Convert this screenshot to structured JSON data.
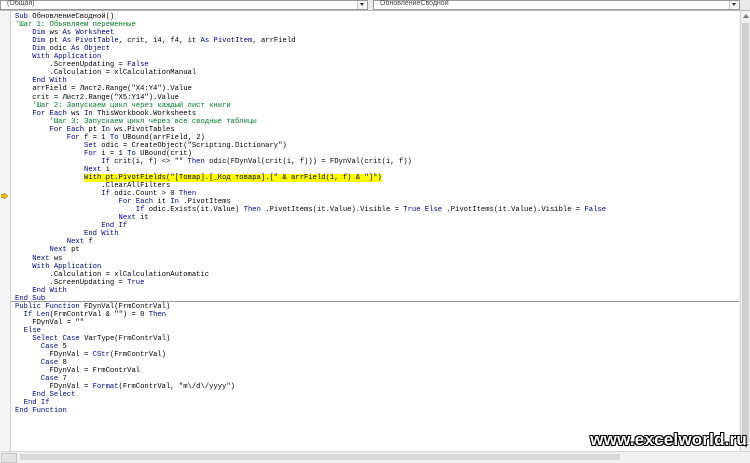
{
  "header": {
    "object_combo": "(Общая)",
    "procedure_combo": "ОбновлениеСводной"
  },
  "watermark": "www.excelworld.ru",
  "code_lines": [
    "Sub ОбновлениеСводной()",
    "'Шаг 1: Объявляем переменные",
    "    Dim ws As Worksheet",
    "    Dim pt As PivotTable, crit, i4, f4, it As PivotItem, arrField",
    "    Dim odic As Object",
    "    With Application",
    "        .ScreenUpdating = False",
    "        .Calculation = xlCalculationManual",
    "    End With",
    "    arrField = Лист2.Range(\"X4:Y4\").Value",
    "    crit = Лист2.Range(\"X5:Y14\").Value",
    "    'Шаг 2: Запускаем цикл через каждый лист книги",
    "    For Each ws In ThisWorkbook.Worksheets",
    "        'Шаг 3: Запускаем цикл через все сводные таблицы",
    "        For Each pt In ws.PivotTables",
    "            For f = 1 To UBound(arrField, 2)",
    "                Set odic = CreateObject(\"Scripting.Dictionary\")",
    "                For i = 1 To UBound(crit)",
    "                    If crit(i, f) <> \"\" Then odic(FDynVal(crit(i, f))) = FDynVal(crit(i, f))",
    "                Next i",
    "                With pt.PivotFields(\"[Товар].[_Код товара].[\" & arrField(1, f) & \"]\")",
    "                    .ClearAllFilters",
    "                    If odic.Count > 0 Then",
    "                        For Each it In .PivotItems",
    "                            If odic.Exists(it.Value) Then .PivotItems(it.Value).Visible = True Else .PivotItems(it.Value).Visible = False",
    "                        Next it",
    "                    End If",
    "                End With",
    "            Next f",
    "        Next pt",
    "    Next ws",
    "    With Application",
    "        .Calculation = xlCalculationAutomatic",
    "        .ScreenUpdating = True",
    "    End With",
    "End Sub",
    "Public Function FDynVal(FrmContrVal)",
    "  If Len(FrmContrVal & \"\") = 0 Then",
    "    FDynVal = \"\"",
    "  Else",
    "    Select Case VarType(FrmContrVal)",
    "      Case 5",
    "        FDynVal = CStr(FrmContrVal)",
    "      Case 8",
    "        FDynVal = FrmContrVal",
    "      Case 7",
    "        FDynVal = Format(FrmContrVal, \"m\\/d\\/yyyy\")",
    "    End Select",
    "  End If",
    "End Function"
  ],
  "highlighted_line_index": 20,
  "colors": {
    "keyword": "#00008b",
    "comment": "#007a2a",
    "highlight": "#ffff00",
    "execution_arrow": "#f5c400"
  },
  "icons": {
    "execution_point": "execution-arrow-icon"
  }
}
